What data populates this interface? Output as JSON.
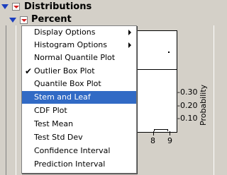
{
  "header": {
    "title": "Distributions"
  },
  "subheader": {
    "title": "Percent"
  },
  "menu": {
    "items": [
      {
        "label": "Display Options",
        "submenu": true,
        "checked": false,
        "selected": false
      },
      {
        "label": "Histogram Options",
        "submenu": true,
        "checked": false,
        "selected": false
      },
      {
        "label": "Normal Quantile Plot",
        "submenu": false,
        "checked": false,
        "selected": false
      },
      {
        "label": "Outlier Box Plot",
        "submenu": false,
        "checked": true,
        "selected": false
      },
      {
        "label": "Quantile Box Plot",
        "submenu": false,
        "checked": false,
        "selected": false
      },
      {
        "label": "Stem and Leaf",
        "submenu": false,
        "checked": false,
        "selected": true
      },
      {
        "label": "CDF Plot",
        "submenu": false,
        "checked": false,
        "selected": false
      },
      {
        "label": "Test Mean",
        "submenu": false,
        "checked": false,
        "selected": false
      },
      {
        "label": "Test Std Dev",
        "submenu": false,
        "checked": false,
        "selected": false
      },
      {
        "label": "Confidence Interval",
        "submenu": false,
        "checked": false,
        "selected": false
      },
      {
        "label": "Prediction Interval",
        "submenu": false,
        "checked": false,
        "selected": false
      }
    ],
    "check_glyph": "✔"
  },
  "plot": {
    "x_ticks": [
      "8",
      "9"
    ],
    "y_ticks": [
      "-0.30",
      "-0.20",
      "-0.10"
    ],
    "y_axis_title": "Probability"
  },
  "colors": {
    "highlight": "#316ac5",
    "disclosure_triangle": "#1c3fbf",
    "popup_arrow": "#d42020",
    "window_bg": "#d4d0c8"
  }
}
